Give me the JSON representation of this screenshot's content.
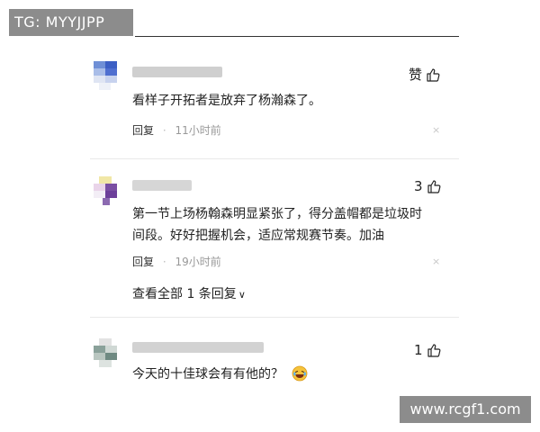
{
  "watermarks": {
    "tag": "TG: MYYJJPP",
    "site": "www.rcgf1.com"
  },
  "comments": [
    {
      "text_lines": [
        "看样子开拓者是放弃了杨瀚森了。"
      ],
      "like_label": "赞",
      "reply_label": "回复",
      "time": "11小时前",
      "close_icon": "×"
    },
    {
      "text_lines": [
        "第一节上场杨翰森明显紧张了，得分盖帽都是垃圾时",
        "间段。好好把握机会，适应常规赛节奏。加油"
      ],
      "like_count": "3",
      "reply_label": "回复",
      "time": "19小时前",
      "close_icon": "×",
      "view_replies": "查看全部 1 条回复",
      "view_replies_icon": "chevron-down-icon"
    },
    {
      "text_lines": [
        "今天的十佳球会有有他的？"
      ],
      "like_count": "1",
      "emoji_icon": "laughing-emoji-icon"
    }
  ],
  "separator": "·",
  "colors": {
    "text": "#222222",
    "meta": "#999999",
    "watermark_bg": "#8c8c8c"
  }
}
